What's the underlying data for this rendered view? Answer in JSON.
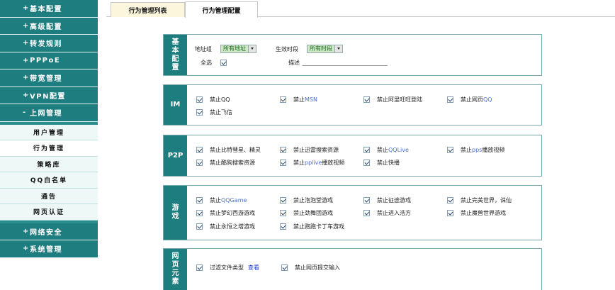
{
  "sidebar": {
    "sign_plus": "+",
    "sign_minus": "-",
    "menus": [
      "基本配置",
      "高级配置",
      "转发规则",
      "PPPoE",
      "带宽管理",
      "VPN配置",
      "上网管理",
      "网络安全",
      "系统管理"
    ],
    "subitems": [
      "用户管理",
      "行为管理",
      "策略库",
      "QQ白名单",
      "通告",
      "网页认证"
    ]
  },
  "tabs": [
    "行为管理列表",
    "行为管理配置"
  ],
  "sections": {
    "basic": {
      "label": [
        "基",
        "本",
        "配",
        "置"
      ],
      "address_group_label": "地址组",
      "address_group_value": "所有地址",
      "period_label": "生效时段",
      "period_value": "所有时段",
      "select_all_label": "全选",
      "description_label": "描述"
    },
    "im": {
      "label": "IM",
      "opt0a": "禁止",
      "opt0b": "QQ",
      "opt1a": "禁止",
      "opt1b": "MSN",
      "opt2": "禁止阿里旺旺登陆",
      "opt3a": "禁止网页",
      "opt3b": "QQ",
      "opt4": "禁止飞信"
    },
    "p2p": {
      "label": "P2P",
      "opt0": "禁止比特彗星、精灵",
      "opt1": "禁止迅雷搜索资源",
      "opt2a": "禁止",
      "opt2b": "QQLive",
      "opt3a": "禁止",
      "opt3b": "pps",
      "opt3c": "播放视频",
      "opt4": "禁止酷狗搜索资源",
      "opt5a": "禁止",
      "opt5b": "pplive",
      "opt5c": "播放视频",
      "opt6": "禁止快播"
    },
    "games": {
      "label": [
        "游",
        "戏"
      ],
      "opt0a": "禁止",
      "opt0b": "QQGame",
      "opt1": "禁止泡泡堂游戏",
      "opt2": "禁止征途游戏",
      "opt3": "禁止完美世界，诛仙",
      "opt4": "禁止梦幻西游游戏",
      "opt5": "禁止劲舞团游戏",
      "opt6": "禁止进入浩方",
      "opt7": "禁止魔兽世界游戏",
      "opt8": "禁止永恒之塔游戏",
      "opt9": "禁止跑跑卡丁车游戏"
    },
    "web": {
      "label": [
        "网",
        "页",
        "元",
        "素"
      ],
      "opt0": "过滤文件类型",
      "view_link": "查看",
      "opt1": "禁止网页提交输入"
    }
  }
}
